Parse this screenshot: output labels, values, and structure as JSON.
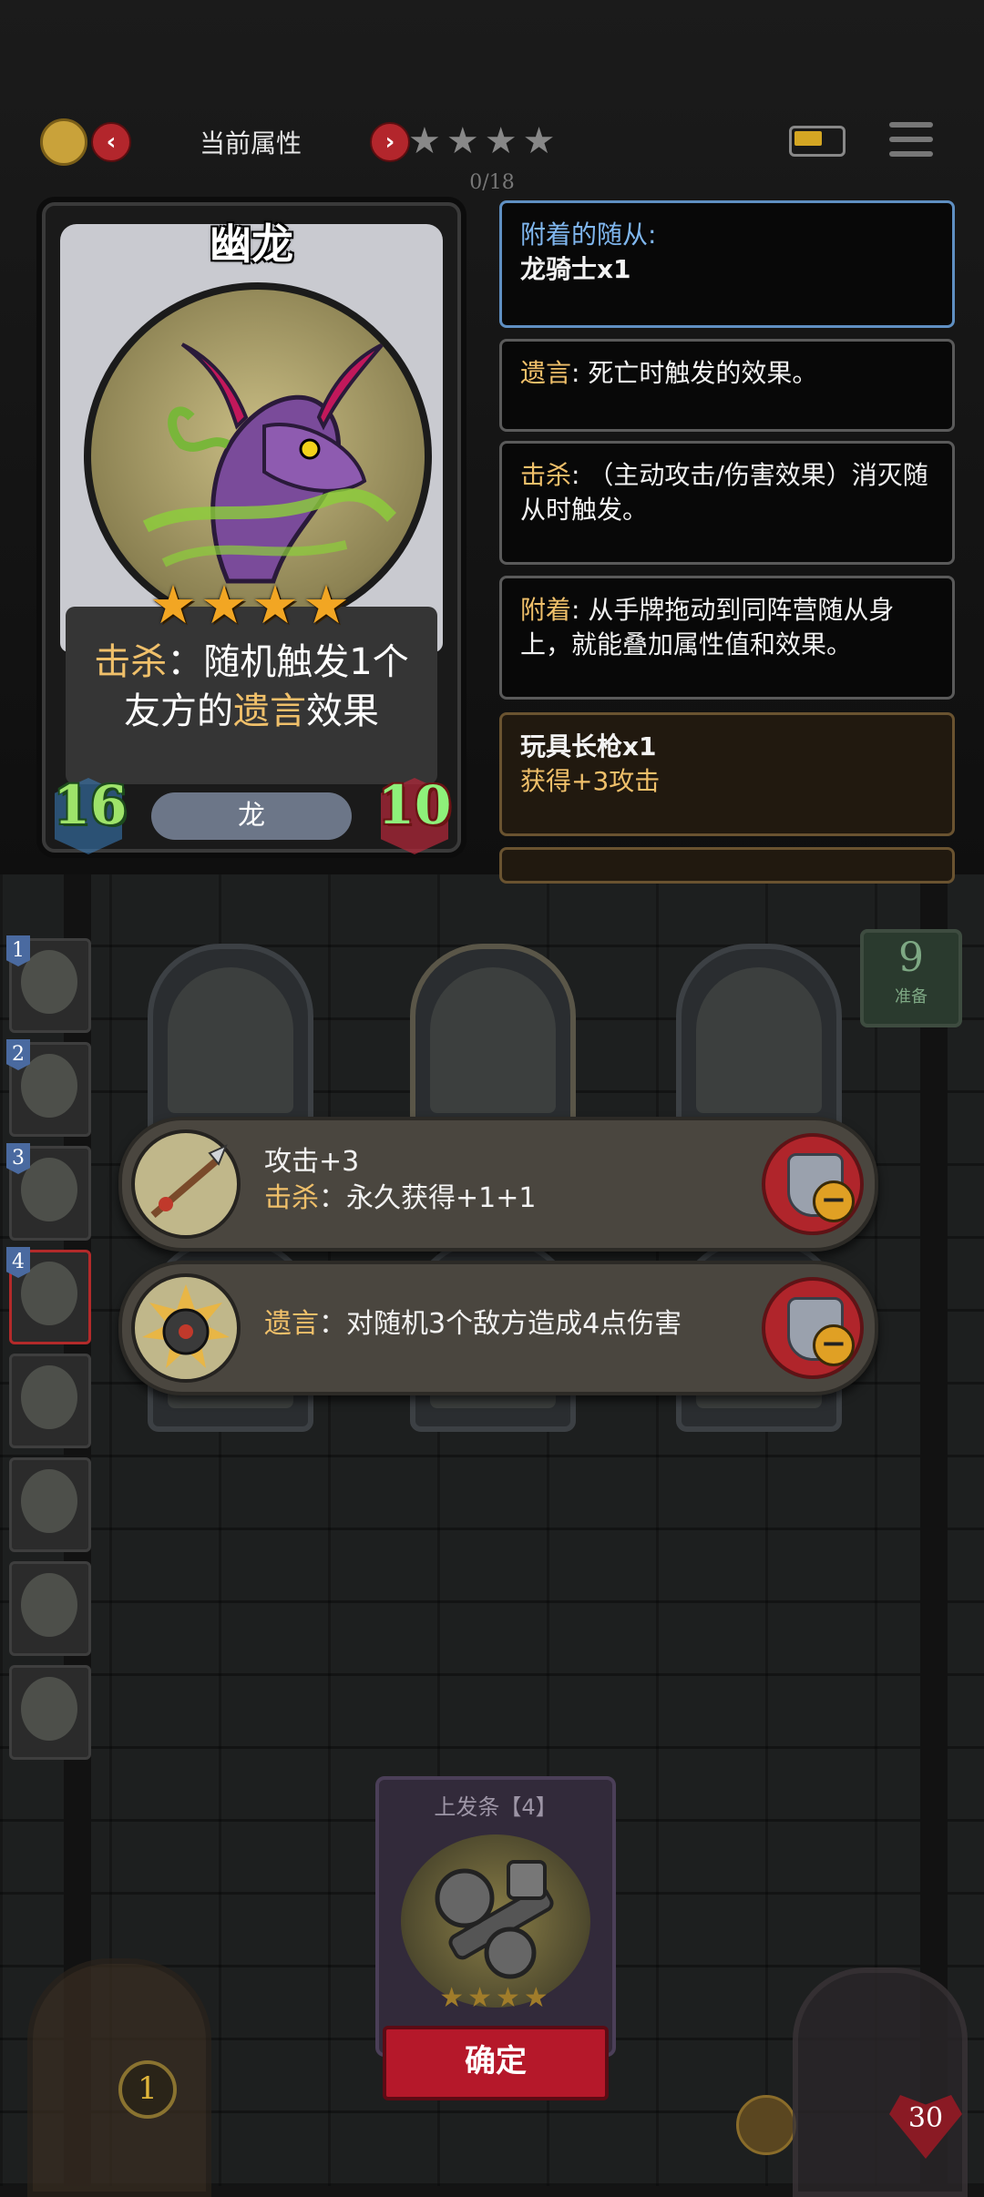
{
  "top_bar": {
    "title": "当前属性",
    "prev_icon": "‹",
    "next_icon": "›",
    "stars": "★★★★",
    "progress": "0/18"
  },
  "hero_card": {
    "name": "幽龙",
    "stars": "★★★★",
    "ability": {
      "keyword": "击杀",
      "text_1": "：随机触发1个",
      "text_2_pre": "友方的",
      "keyword_2": "遗言",
      "text_2_post": "效果"
    },
    "attack": "16",
    "health": "10",
    "tribe": "龙"
  },
  "info_panels": {
    "attached_title": "附着的随从:",
    "attached_item": "龙骑士x1",
    "deathrattle_kw": "遗言",
    "deathrattle_text": ": 死亡时触发的效果。",
    "kill_kw": "击杀",
    "kill_text": ": （主动攻击/伤害效果）消灭随从时触发。",
    "attach_kw": "附着",
    "attach_text": ": 从手牌拖动到同阵营随从身上，就能叠加属性值和效果。",
    "lance_name": "玩具长枪x1",
    "lance_effect": "获得+3攻击"
  },
  "deck": {
    "count": "9",
    "label": "准备"
  },
  "hand_numbers": [
    "1",
    "2",
    "3",
    "4"
  ],
  "effects": [
    {
      "line_1": "攻击+3",
      "keyword": "击杀",
      "line_2": "：永久获得+1+1"
    },
    {
      "keyword": "遗言",
      "line_1": "：对随机3个敌方造成4点伤害"
    }
  ],
  "item_card": {
    "title": "上发条【4】",
    "stars": "★★★★"
  },
  "confirm_label": "确定",
  "coins": "1",
  "hp": "30",
  "colors": {
    "keyword_gold": "#f0c06a",
    "remove_red": "#b0252b",
    "confirm_red": "#b5182a",
    "attached_blue": "#7fb6ee"
  }
}
